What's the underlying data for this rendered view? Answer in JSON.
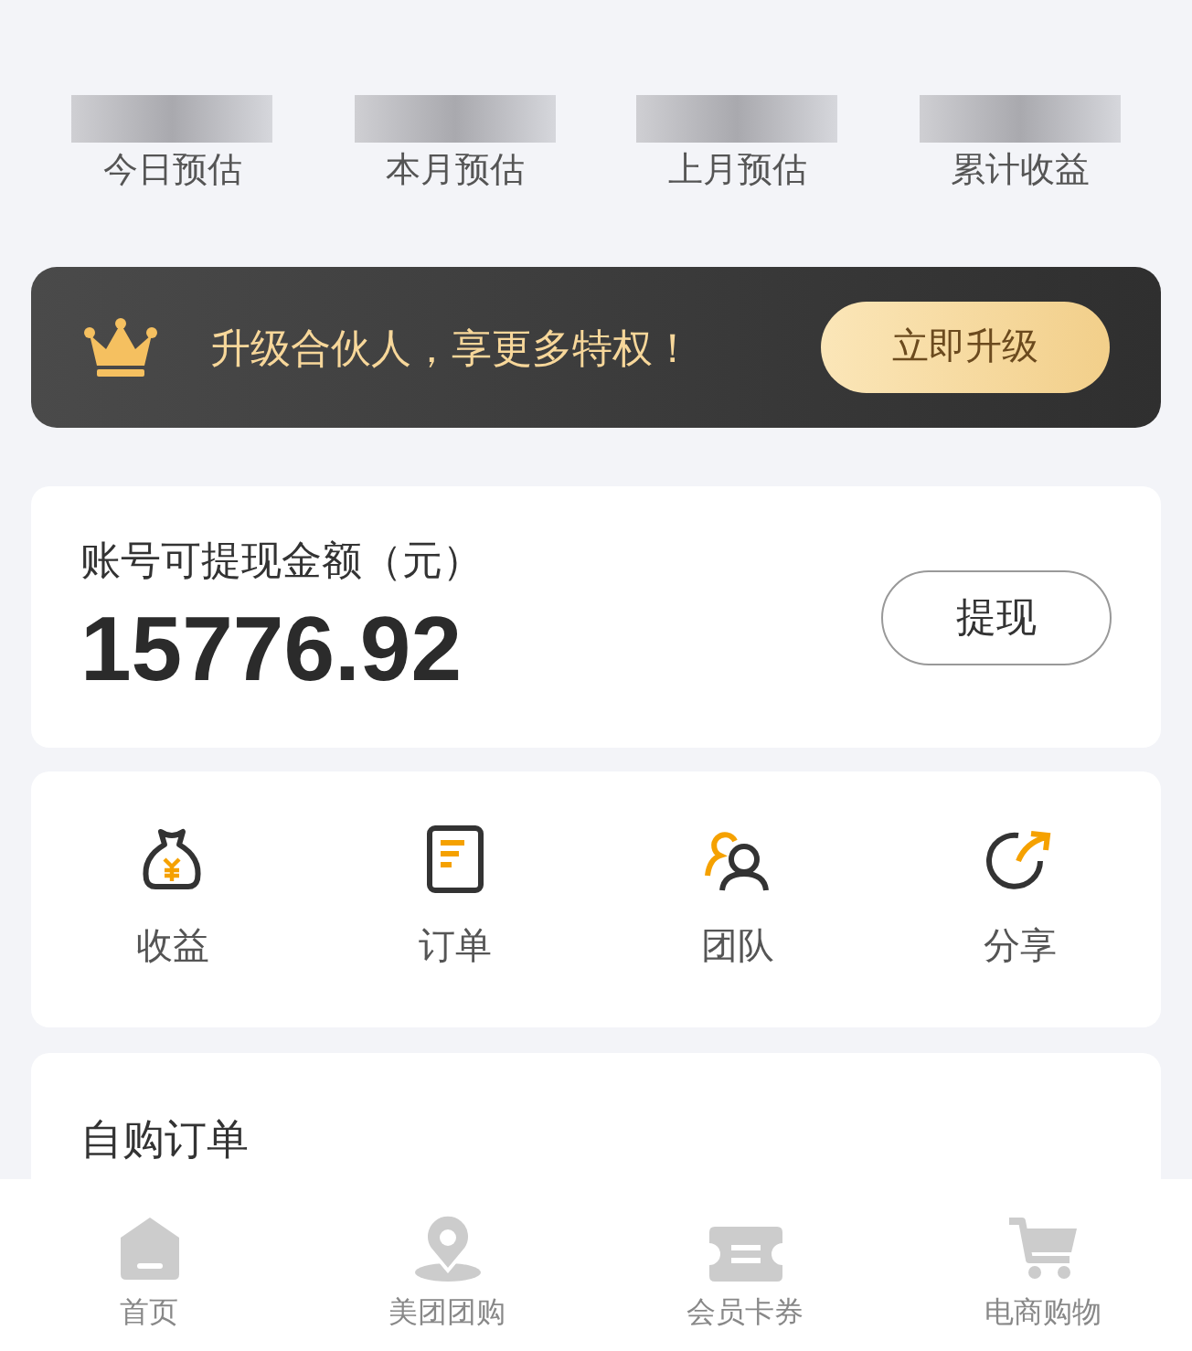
{
  "stats": [
    {
      "label": "今日预估"
    },
    {
      "label": "本月预估"
    },
    {
      "label": "上月预估"
    },
    {
      "label": "累计收益"
    }
  ],
  "banner": {
    "text": "升级合伙人，享更多特权！",
    "button": "立即升级"
  },
  "balance": {
    "label": "账号可提现金额（元）",
    "amount": "15776.92",
    "button": "提现"
  },
  "shortcuts": [
    {
      "kind": "bag",
      "label": "收益"
    },
    {
      "kind": "doc",
      "label": "订单"
    },
    {
      "kind": "team",
      "label": "团队"
    },
    {
      "kind": "share",
      "label": "分享"
    }
  ],
  "orders": {
    "title": "自购订单"
  },
  "tab_bar": [
    {
      "kind": "home",
      "label": "首页"
    },
    {
      "kind": "pin",
      "label": "美团团购"
    },
    {
      "kind": "ticket",
      "label": "会员卡券"
    },
    {
      "kind": "cart",
      "label": "电商购物"
    }
  ]
}
